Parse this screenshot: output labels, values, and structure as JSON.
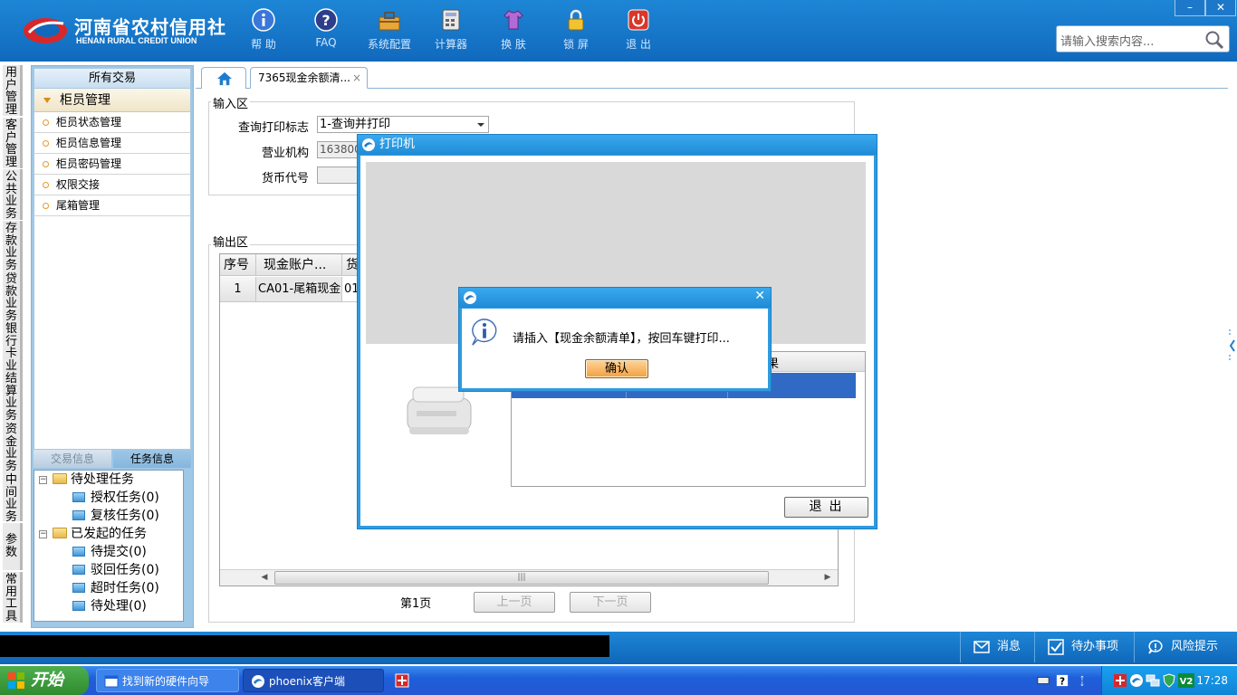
{
  "brand": {
    "title": "河南省农村信用社",
    "subtitle": "HENAN RURAL CREDIT UNION"
  },
  "toolbar": [
    {
      "label": "帮 助",
      "icon": "info-icon"
    },
    {
      "label": "FAQ",
      "icon": "help-icon"
    },
    {
      "label": "系统配置",
      "icon": "toolbox-icon"
    },
    {
      "label": "计算器",
      "icon": "calculator-icon"
    },
    {
      "label": "换 肤",
      "icon": "shirt-icon"
    },
    {
      "label": "锁 屏",
      "icon": "lock-icon"
    },
    {
      "label": "退 出",
      "icon": "power-icon"
    }
  ],
  "window": {
    "minimize": "–",
    "close": "✕"
  },
  "search": {
    "placeholder": "请输入搜索内容..."
  },
  "vbar": [
    {
      "label": "用户管理"
    },
    {
      "label": "客户管理"
    },
    {
      "label": "公共业务"
    },
    {
      "label": "存款业务"
    },
    {
      "label": "贷款业务"
    },
    {
      "label": "银行卡业务"
    },
    {
      "label": "结算业务"
    },
    {
      "label": "资金业务"
    },
    {
      "label": "中间业务"
    },
    {
      "label": "参数"
    },
    {
      "label": "常用工具"
    }
  ],
  "menu": {
    "header": "所有交易",
    "group": "柜员管理",
    "items": [
      {
        "label": "柜员状态管理"
      },
      {
        "label": "柜员信息管理"
      },
      {
        "label": "柜员密码管理"
      },
      {
        "label": "权限交接"
      },
      {
        "label": "尾箱管理"
      }
    ]
  },
  "lower_tabs": {
    "trans_info": "交易信息",
    "task_info": "任务信息"
  },
  "tree": {
    "pending": "待处理任务",
    "auth": "授权任务(0)",
    "review": "复核任务(0)",
    "initiated": "已发起的任务",
    "to_submit": "待提交(0)",
    "rejected": "驳回任务(0)",
    "timeout": "超时任务(0)",
    "to_process": "待处理(0)"
  },
  "tabs": {
    "doc": "7365现金余额清...",
    "close": "×"
  },
  "input_area": {
    "legend": "输入区",
    "query_label": "查询打印标志",
    "query_value": "1-查询并打印",
    "org_label": "营业机构",
    "org_value": "163800",
    "currency_label": "货币代号",
    "currency_value": ""
  },
  "output_area": {
    "legend": "输出区",
    "columns": [
      "序号",
      "现金账户...",
      "货"
    ],
    "rows": [
      [
        "1",
        "CA01-尾箱现金",
        "01"
      ]
    ]
  },
  "pager": {
    "page": "第1页",
    "prev": "上一页",
    "next": "下一页"
  },
  "printer_dialog": {
    "title": "打印机",
    "result_col": "果",
    "exit": "退出"
  },
  "confirm_dialog": {
    "message": "请插入【现金余额清单】，按回车键打印...",
    "ok": "确认",
    "close": "✕"
  },
  "statusbar": {
    "message": "消息",
    "todo": "待办事项",
    "risk": "风险提示"
  },
  "taskbar": {
    "start": "开始",
    "items": [
      {
        "label": "找到新的硬件向导"
      },
      {
        "label": "phoenix客户端"
      }
    ],
    "clock": "17:28"
  },
  "colors": {
    "header_blue": "#1169bd",
    "dialog_blue": "#2f9bdf",
    "selection": "#316ac5",
    "ok_button": "#f3a040"
  }
}
